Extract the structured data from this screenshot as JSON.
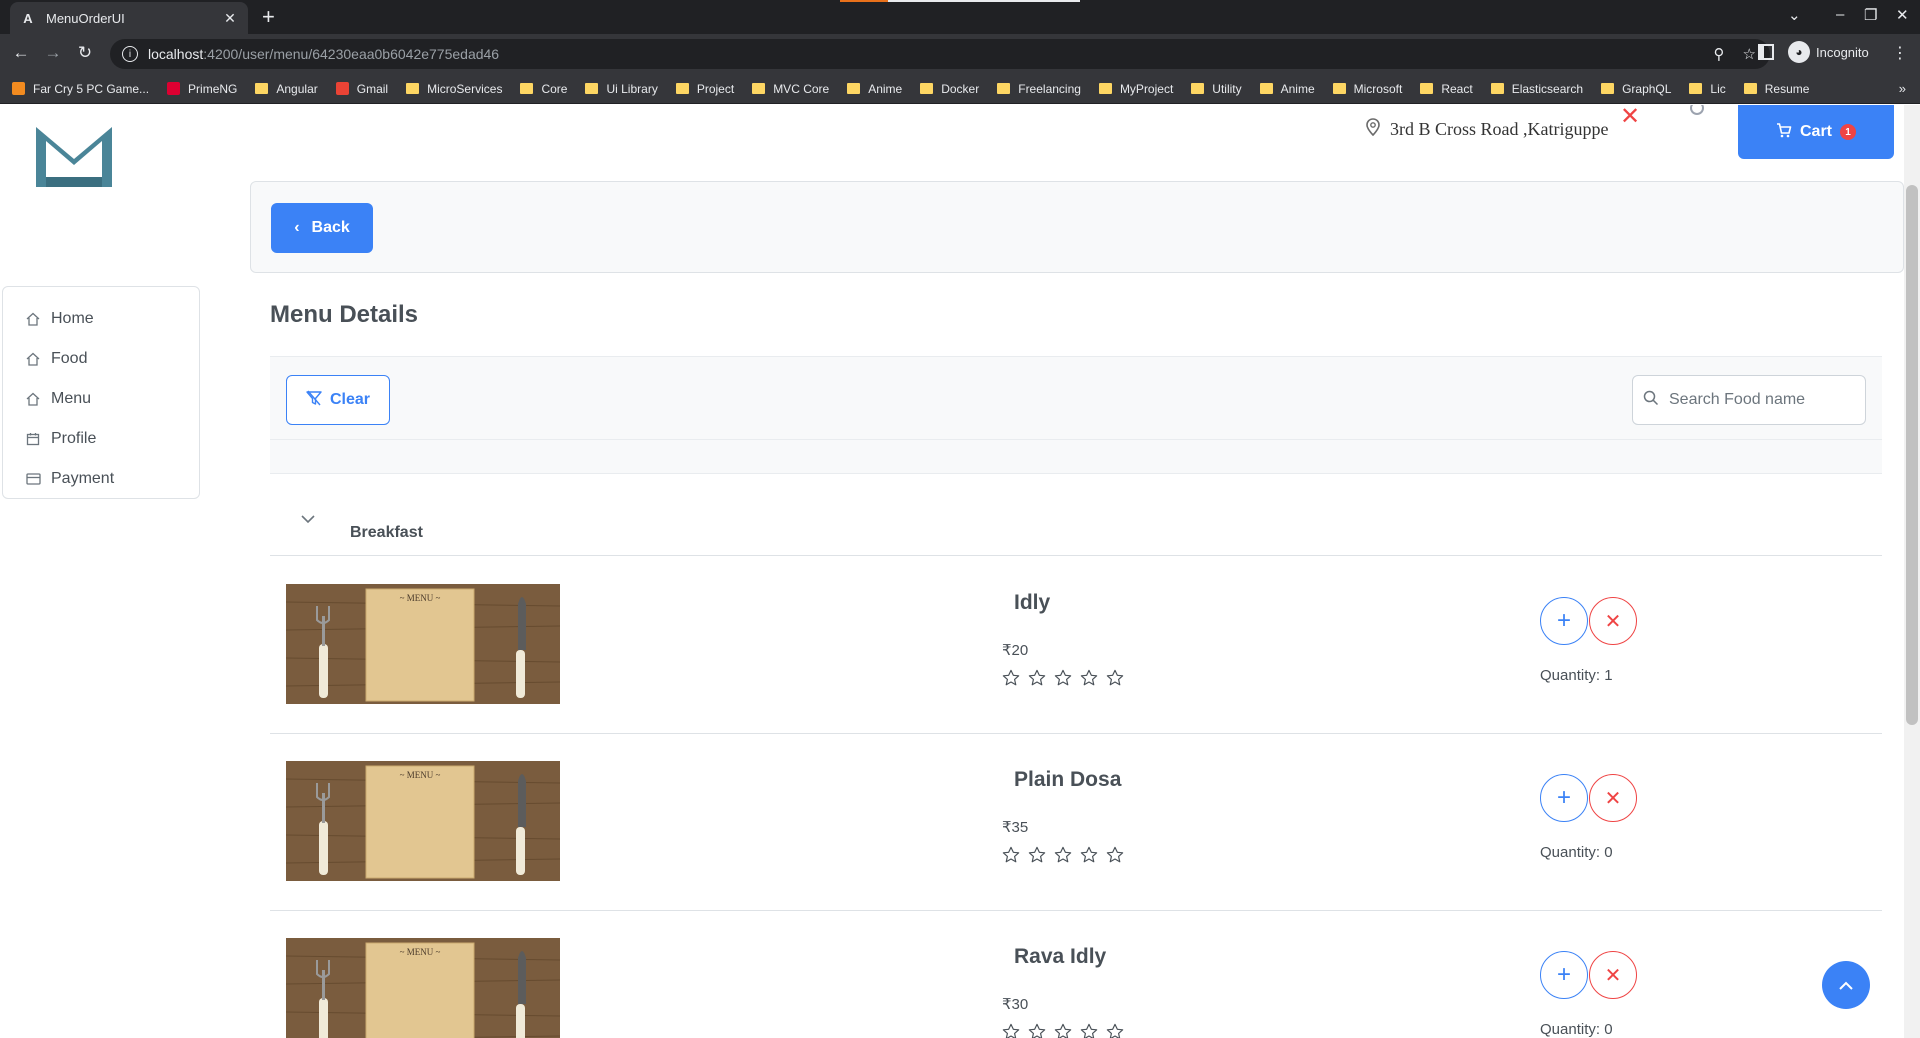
{
  "browser": {
    "tab_title": "MenuOrderUI",
    "tab_favicon": "A",
    "url_host": "localhost",
    "url_path": ":4200/user/menu/64230eaa0b6042e775edad46",
    "profile_label": "Incognito",
    "bookmarks": [
      {
        "label": "Far Cry 5 PC Game...",
        "type": "site",
        "color": "#f28b20"
      },
      {
        "label": "PrimeNG",
        "type": "site",
        "color": "#dd0031"
      },
      {
        "label": "Angular",
        "type": "folder"
      },
      {
        "label": "Gmail",
        "type": "site",
        "color": "#ea4335"
      },
      {
        "label": "MicroServices",
        "type": "folder"
      },
      {
        "label": "Core",
        "type": "folder"
      },
      {
        "label": "Ui Library",
        "type": "folder"
      },
      {
        "label": "Project",
        "type": "folder"
      },
      {
        "label": "MVC Core",
        "type": "folder"
      },
      {
        "label": "Anime",
        "type": "folder"
      },
      {
        "label": "Docker",
        "type": "folder"
      },
      {
        "label": "Freelancing",
        "type": "folder"
      },
      {
        "label": "MyProject",
        "type": "folder"
      },
      {
        "label": "Utility",
        "type": "folder"
      },
      {
        "label": "Anime",
        "type": "folder"
      },
      {
        "label": "Microsoft",
        "type": "folder"
      },
      {
        "label": "React",
        "type": "folder"
      },
      {
        "label": "Elasticsearch",
        "type": "folder"
      },
      {
        "label": "GraphQL",
        "type": "folder"
      },
      {
        "label": "Lic",
        "type": "folder"
      },
      {
        "label": "Resume",
        "type": "folder"
      }
    ],
    "bookmarks_more": "»"
  },
  "header": {
    "address": "3rd B Cross Road ,Katriguppe",
    "cart_label": "Cart",
    "cart_count": "1"
  },
  "sidebar": {
    "items": [
      {
        "label": "Home",
        "icon": "home-icon"
      },
      {
        "label": "Food",
        "icon": "home-icon"
      },
      {
        "label": "Menu",
        "icon": "home-icon"
      },
      {
        "label": "Profile",
        "icon": "calendar-icon"
      },
      {
        "label": "Payment",
        "icon": "credit-card-icon"
      }
    ]
  },
  "main": {
    "back_label": "Back",
    "title": "Menu Details",
    "clear_label": "Clear",
    "search_placeholder": "Search Food name",
    "search_value": "",
    "group": "Breakfast",
    "items": [
      {
        "name": "Idly",
        "price": "₹20",
        "quantity": "Quantity: 1",
        "rating": 0,
        "image_label": "~ MENU ~"
      },
      {
        "name": "Plain Dosa",
        "price": "₹35",
        "quantity": "Quantity: 0",
        "rating": 0,
        "image_label": "~ MENU ~"
      },
      {
        "name": "Rava Idly",
        "price": "₹30",
        "quantity": "Quantity: 0",
        "rating": 0,
        "image_label": "~ MENU ~"
      }
    ]
  },
  "colors": {
    "primary": "#3b82f6",
    "danger": "#ef4444",
    "brand_logo": "#4a8598"
  }
}
